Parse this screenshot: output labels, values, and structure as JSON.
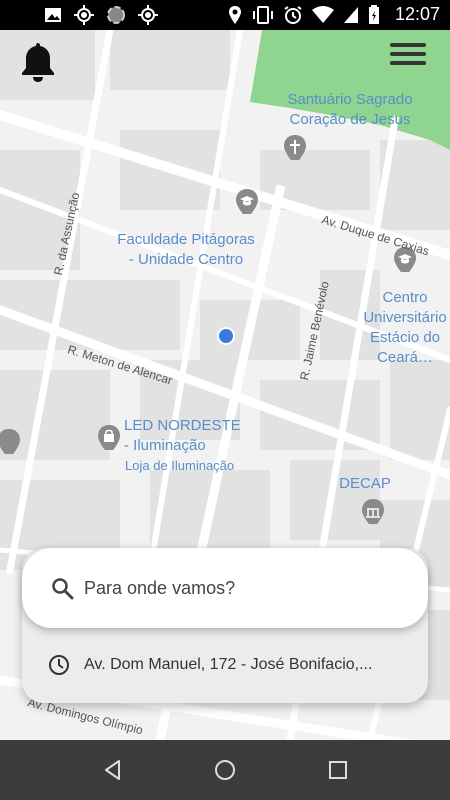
{
  "status_bar": {
    "time": "12:07",
    "left_icons": [
      "image-icon",
      "location-target-icon",
      "loading-circle-icon",
      "location-target-icon"
    ],
    "right_icons": [
      "location-pin-icon",
      "vibrate-icon",
      "alarm-icon",
      "wifi-icon",
      "signal-icon",
      "battery-icon"
    ]
  },
  "map": {
    "places": {
      "santuario": "Santuário Sagrado\nCoração de Jesus",
      "faculdade": "Faculdade Pitágoras\n- Unidade Centro",
      "centro_universitario": "Centro\nUniversitário\nEstácio do\nCeará…",
      "led": "LED NORDESTE\n- Iluminação",
      "led_sub": "Loja de Iluminação",
      "decap": "DECAP"
    },
    "streets": {
      "duque": "Av. Duque de Caxias",
      "assuncao": "R. da Assunção",
      "meton": "R. Meton de Alencar",
      "jaime": "R. Jaime Benévolo",
      "domingos": "Av. Domingos Olímpio"
    }
  },
  "header": {
    "notifications_icon": "bell-icon",
    "menu_icon": "hamburger-menu-icon"
  },
  "search": {
    "placeholder": "Para onde vamos?",
    "icon": "search-icon"
  },
  "recent": {
    "address": "Av. Dom Manuel, 172 - José Bonifacio,...",
    "icon": "clock-icon"
  },
  "nav_bar": {
    "back_icon": "back-triangle-icon",
    "home_icon": "home-circle-icon",
    "recents_icon": "recents-square-icon"
  },
  "colors": {
    "map_bg": "#f2f2f2",
    "park": "#8fd48f",
    "place_label": "#5a8ec8",
    "location_dot": "#3b7ae0",
    "nav_bar": "#3c3c3c"
  }
}
